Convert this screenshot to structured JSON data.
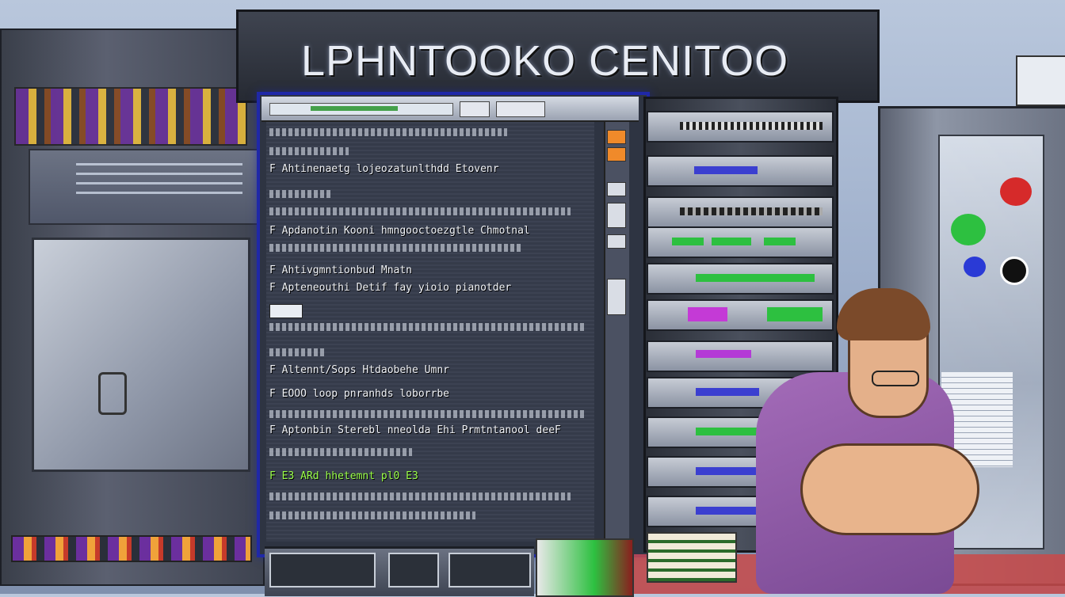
{
  "sign": {
    "title": "LPHNTOOKO CENITOO"
  },
  "terminal": {
    "lines": [
      {
        "text": "F Ahtinenaetg lojeozatunlthdd Etovenr",
        "style": "normal"
      },
      {
        "text": "F Apdanotin Kooni hmngooctoezgtle Chmotnal",
        "style": "normal"
      },
      {
        "text": "F Ahtivgmntionbud Mnatn",
        "style": "normal"
      },
      {
        "text": "F Apteneouthi Detif fay yioio pianotder",
        "style": "normal"
      },
      {
        "text": "F Altennt/Sops Htdaobehe Umnr",
        "style": "normal"
      },
      {
        "text": "F EOOO loop pnranhds loborrbe",
        "style": "normal"
      },
      {
        "text": "F Aptonbin Sterebl nneolda Ehi Prmtntanool deeF",
        "style": "normal"
      },
      {
        "text": "F E3 ARd hhetemnt pl0 E3",
        "style": "green"
      }
    ]
  },
  "icons": {
    "window-controls": "window-buttons",
    "scroll-up": "scroll-arrow",
    "decorative": [
      "gear-icon",
      "sticker-icon"
    ]
  },
  "colors": {
    "monitor_border": "#1f28a8",
    "term_green": "#9bff4a",
    "accent_orange": "#f08a2a"
  }
}
